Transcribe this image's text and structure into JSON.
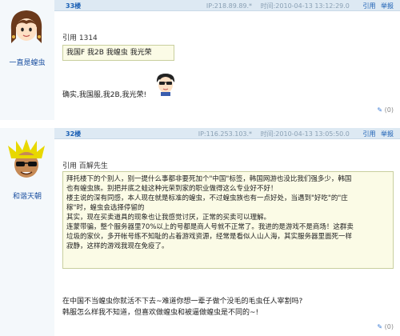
{
  "post1": {
    "username": "一直是蝗虫",
    "floor": "33楼",
    "ip": "IP:218.89.89.*",
    "time": "时间:2010-04-13 13:12:29.0",
    "action_quote": "引用",
    "action_report": "举报",
    "quote_label": "引用 1314",
    "quote_text": "我国F 我2B 我蝗虫 我光荣",
    "body": "确实,我国服,我2B,我光荣!",
    "reply_prefix": "(",
    "reply_count": "0",
    "reply_suffix": ")"
  },
  "post2": {
    "username": "和谐天朝",
    "floor": "32楼",
    "ip": "IP:116.253.103.*",
    "time": "时间:2010-04-13 13:05:50.0",
    "action_quote": "引用",
    "action_report": "举报",
    "quote_label": "引用 百解先生",
    "quote_lines": [
      "拜托楼下的个别人，别一提什么事都非要死加个\"中国\"标签，韩国网游也没比我们强多少，韩国",
      "也有蝗虫族。别把并底之蛙这种光荣到家的职业做得这么专业好不好！",
      "楼主说的深有同感，本人现在就是标准的蝗虫，不过蝗虫族也有一点好处，当遇到\"好吃\"的\"庄",
      "稼\"时，蝗虫会选择停留的",
      "其实，现在买卖道具的现象也让我感觉讨厌，正常的买卖可以理解。",
      "连蒙带骗，整个服务器里70%以上的号都是商人号就不正常了。我进的是游戏不是商场！这群卖",
      "垃圾的家伙，多开帐号练不知耻的占着游戏资源，经常是看似人山人海，其实服务器里面死一样",
      "寂静，这样的游戏我现在免疫了。"
    ],
    "body_lines": [
      "在中国不当蝗虫你就活不下去~难道你想一辈子做个没毛的毛虫任人宰割吗?",
      "韩服怎么样我不知道，但喜欢做蝗虫和被逼做蝗虫是不同的~!"
    ],
    "reply_prefix": "(",
    "reply_count": "0",
    "reply_suffix": ")"
  },
  "icons": {
    "avatar1": "girl-avatar-icon",
    "avatar2": "spiky-hair-avatar-icon",
    "sticker": "sunglasses-sticker-icon",
    "reply": "reply-icon"
  },
  "colors": {
    "header_bg": "#dde9f3",
    "link": "#1a5fb4",
    "quote_bg": "#fbfbe6",
    "quote_border": "#c9cf9e"
  }
}
